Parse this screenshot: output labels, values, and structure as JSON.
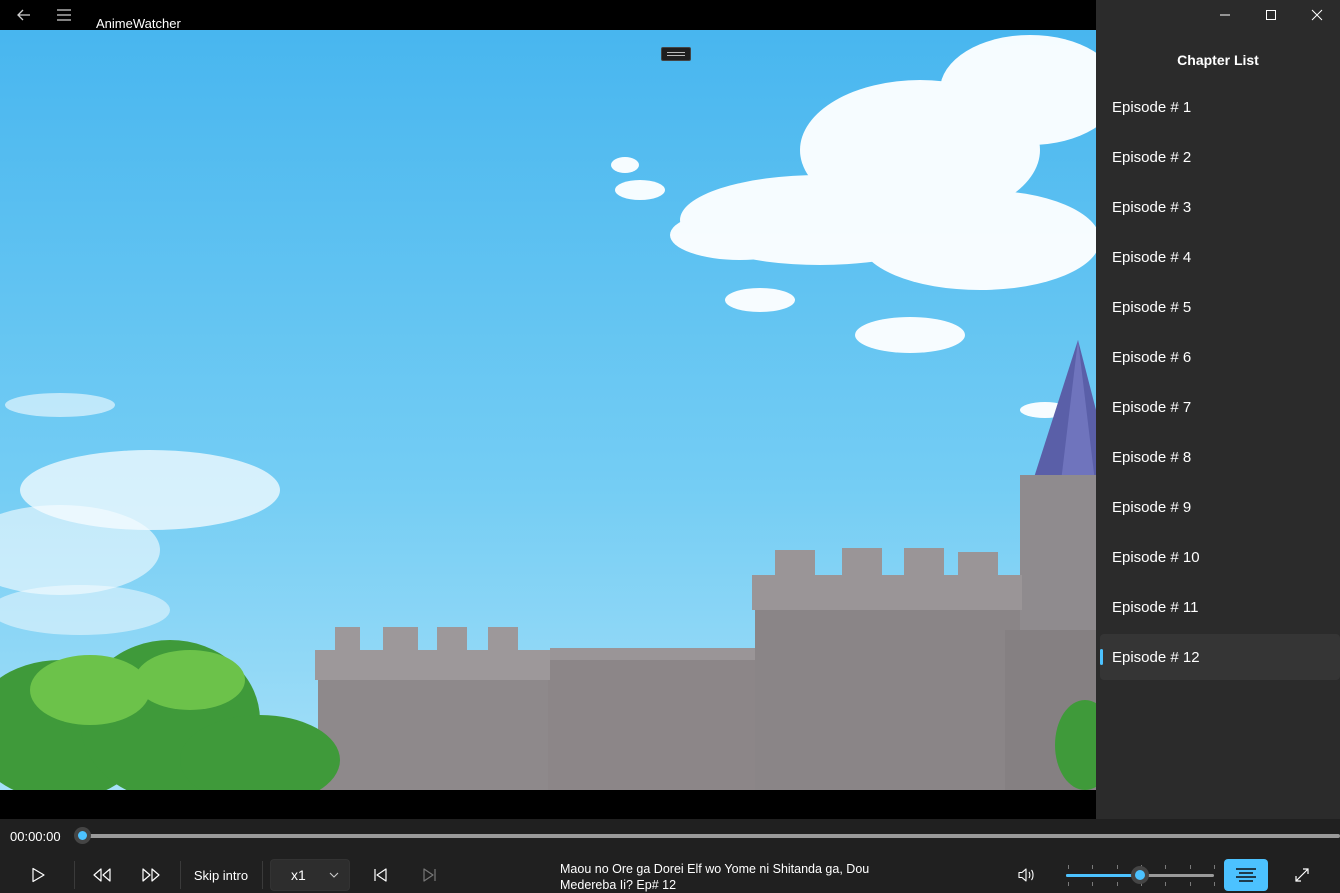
{
  "app": {
    "title": "AnimeWatcher"
  },
  "side_panel": {
    "title": "Chapter List",
    "selected_index": 11,
    "episodes": [
      "Episode # 1",
      "Episode # 2",
      "Episode # 3",
      "Episode # 4",
      "Episode # 5",
      "Episode # 6",
      "Episode # 7",
      "Episode # 8",
      "Episode # 9",
      "Episode # 10",
      "Episode # 11",
      "Episode # 12"
    ]
  },
  "player": {
    "current_time": "00:00:00",
    "progress": 0,
    "skip_intro_label": "Skip intro",
    "speed": "x1",
    "now_playing_line1": "Maou no Ore ga Dorei Elf wo Yome ni Shitanda ga, Dou",
    "now_playing_line2": "Medereba Ii?  Ep# 12",
    "volume": 0.5
  },
  "icons": {
    "back": "back-arrow-icon",
    "menu": "hamburger-menu-icon",
    "minimize": "minimize-icon",
    "maximize": "maximize-icon",
    "close": "close-icon",
    "play": "play-icon",
    "rewind": "rewind-icon",
    "fast_forward": "fast-forward-icon",
    "previous": "skip-previous-icon",
    "next": "skip-next-icon",
    "volume": "volume-icon",
    "chapter_list": "list-icon",
    "fullscreen": "fullscreen-icon"
  },
  "colors": {
    "accent": "#4cc2ff",
    "panel": "#2b2b2b",
    "controls": "#202020"
  }
}
